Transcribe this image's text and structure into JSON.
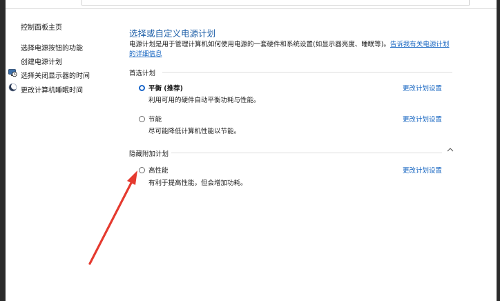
{
  "sidebar": {
    "home": "控制面板主页",
    "items": [
      {
        "label": "选择电源按钮的功能",
        "icon": ""
      },
      {
        "label": "创建电源计划",
        "icon": ""
      },
      {
        "label": "选择关闭显示器的时间",
        "icon": "monitor-clock-icon"
      },
      {
        "label": "更改计算机睡眠时间",
        "icon": "moon-icon"
      }
    ]
  },
  "main": {
    "title": "选择或自定义电源计划",
    "description": "电源计划是用于管理计算机如何使用电源的一套硬件和系统设置(如显示器亮度、睡眠等)。",
    "description_link": "告诉我有关电源计划的详细信息",
    "preferred_section": "首选计划",
    "hidden_section": "隐藏附加计划",
    "plans": [
      {
        "name": "平衡 (推荐)",
        "desc": "利用可用的硬件自动平衡功耗与性能。",
        "selected": true,
        "link": "更改计划设置"
      },
      {
        "name": "节能",
        "desc": "尽可能降低计算机性能以节能。",
        "selected": false,
        "link": "更改计划设置"
      },
      {
        "name": "高性能",
        "desc": "有利于提高性能，但会增加功耗。",
        "selected": false,
        "link": "更改计划设置"
      }
    ]
  },
  "colors": {
    "title": "#1e5fa8",
    "link": "#1665c1",
    "radio_selected": "#1a66c9",
    "annotation_arrow": "#e53a2f"
  }
}
